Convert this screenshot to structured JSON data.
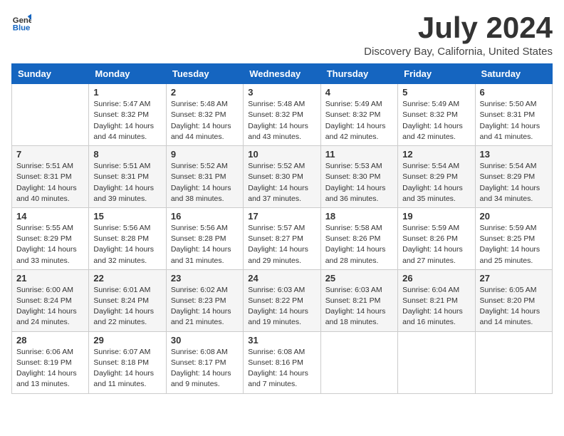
{
  "header": {
    "logo_general": "General",
    "logo_blue": "Blue",
    "title": "July 2024",
    "subtitle": "Discovery Bay, California, United States"
  },
  "days_of_week": [
    "Sunday",
    "Monday",
    "Tuesday",
    "Wednesday",
    "Thursday",
    "Friday",
    "Saturday"
  ],
  "weeks": [
    [
      {
        "day": "",
        "info": ""
      },
      {
        "day": "1",
        "info": "Sunrise: 5:47 AM\nSunset: 8:32 PM\nDaylight: 14 hours\nand 44 minutes."
      },
      {
        "day": "2",
        "info": "Sunrise: 5:48 AM\nSunset: 8:32 PM\nDaylight: 14 hours\nand 44 minutes."
      },
      {
        "day": "3",
        "info": "Sunrise: 5:48 AM\nSunset: 8:32 PM\nDaylight: 14 hours\nand 43 minutes."
      },
      {
        "day": "4",
        "info": "Sunrise: 5:49 AM\nSunset: 8:32 PM\nDaylight: 14 hours\nand 42 minutes."
      },
      {
        "day": "5",
        "info": "Sunrise: 5:49 AM\nSunset: 8:32 PM\nDaylight: 14 hours\nand 42 minutes."
      },
      {
        "day": "6",
        "info": "Sunrise: 5:50 AM\nSunset: 8:31 PM\nDaylight: 14 hours\nand 41 minutes."
      }
    ],
    [
      {
        "day": "7",
        "info": "Sunrise: 5:51 AM\nSunset: 8:31 PM\nDaylight: 14 hours\nand 40 minutes."
      },
      {
        "day": "8",
        "info": "Sunrise: 5:51 AM\nSunset: 8:31 PM\nDaylight: 14 hours\nand 39 minutes."
      },
      {
        "day": "9",
        "info": "Sunrise: 5:52 AM\nSunset: 8:31 PM\nDaylight: 14 hours\nand 38 minutes."
      },
      {
        "day": "10",
        "info": "Sunrise: 5:52 AM\nSunset: 8:30 PM\nDaylight: 14 hours\nand 37 minutes."
      },
      {
        "day": "11",
        "info": "Sunrise: 5:53 AM\nSunset: 8:30 PM\nDaylight: 14 hours\nand 36 minutes."
      },
      {
        "day": "12",
        "info": "Sunrise: 5:54 AM\nSunset: 8:29 PM\nDaylight: 14 hours\nand 35 minutes."
      },
      {
        "day": "13",
        "info": "Sunrise: 5:54 AM\nSunset: 8:29 PM\nDaylight: 14 hours\nand 34 minutes."
      }
    ],
    [
      {
        "day": "14",
        "info": "Sunrise: 5:55 AM\nSunset: 8:29 PM\nDaylight: 14 hours\nand 33 minutes."
      },
      {
        "day": "15",
        "info": "Sunrise: 5:56 AM\nSunset: 8:28 PM\nDaylight: 14 hours\nand 32 minutes."
      },
      {
        "day": "16",
        "info": "Sunrise: 5:56 AM\nSunset: 8:28 PM\nDaylight: 14 hours\nand 31 minutes."
      },
      {
        "day": "17",
        "info": "Sunrise: 5:57 AM\nSunset: 8:27 PM\nDaylight: 14 hours\nand 29 minutes."
      },
      {
        "day": "18",
        "info": "Sunrise: 5:58 AM\nSunset: 8:26 PM\nDaylight: 14 hours\nand 28 minutes."
      },
      {
        "day": "19",
        "info": "Sunrise: 5:59 AM\nSunset: 8:26 PM\nDaylight: 14 hours\nand 27 minutes."
      },
      {
        "day": "20",
        "info": "Sunrise: 5:59 AM\nSunset: 8:25 PM\nDaylight: 14 hours\nand 25 minutes."
      }
    ],
    [
      {
        "day": "21",
        "info": "Sunrise: 6:00 AM\nSunset: 8:24 PM\nDaylight: 14 hours\nand 24 minutes."
      },
      {
        "day": "22",
        "info": "Sunrise: 6:01 AM\nSunset: 8:24 PM\nDaylight: 14 hours\nand 22 minutes."
      },
      {
        "day": "23",
        "info": "Sunrise: 6:02 AM\nSunset: 8:23 PM\nDaylight: 14 hours\nand 21 minutes."
      },
      {
        "day": "24",
        "info": "Sunrise: 6:03 AM\nSunset: 8:22 PM\nDaylight: 14 hours\nand 19 minutes."
      },
      {
        "day": "25",
        "info": "Sunrise: 6:03 AM\nSunset: 8:21 PM\nDaylight: 14 hours\nand 18 minutes."
      },
      {
        "day": "26",
        "info": "Sunrise: 6:04 AM\nSunset: 8:21 PM\nDaylight: 14 hours\nand 16 minutes."
      },
      {
        "day": "27",
        "info": "Sunrise: 6:05 AM\nSunset: 8:20 PM\nDaylight: 14 hours\nand 14 minutes."
      }
    ],
    [
      {
        "day": "28",
        "info": "Sunrise: 6:06 AM\nSunset: 8:19 PM\nDaylight: 14 hours\nand 13 minutes."
      },
      {
        "day": "29",
        "info": "Sunrise: 6:07 AM\nSunset: 8:18 PM\nDaylight: 14 hours\nand 11 minutes."
      },
      {
        "day": "30",
        "info": "Sunrise: 6:08 AM\nSunset: 8:17 PM\nDaylight: 14 hours\nand 9 minutes."
      },
      {
        "day": "31",
        "info": "Sunrise: 6:08 AM\nSunset: 8:16 PM\nDaylight: 14 hours\nand 7 minutes."
      },
      {
        "day": "",
        "info": ""
      },
      {
        "day": "",
        "info": ""
      },
      {
        "day": "",
        "info": ""
      }
    ]
  ]
}
